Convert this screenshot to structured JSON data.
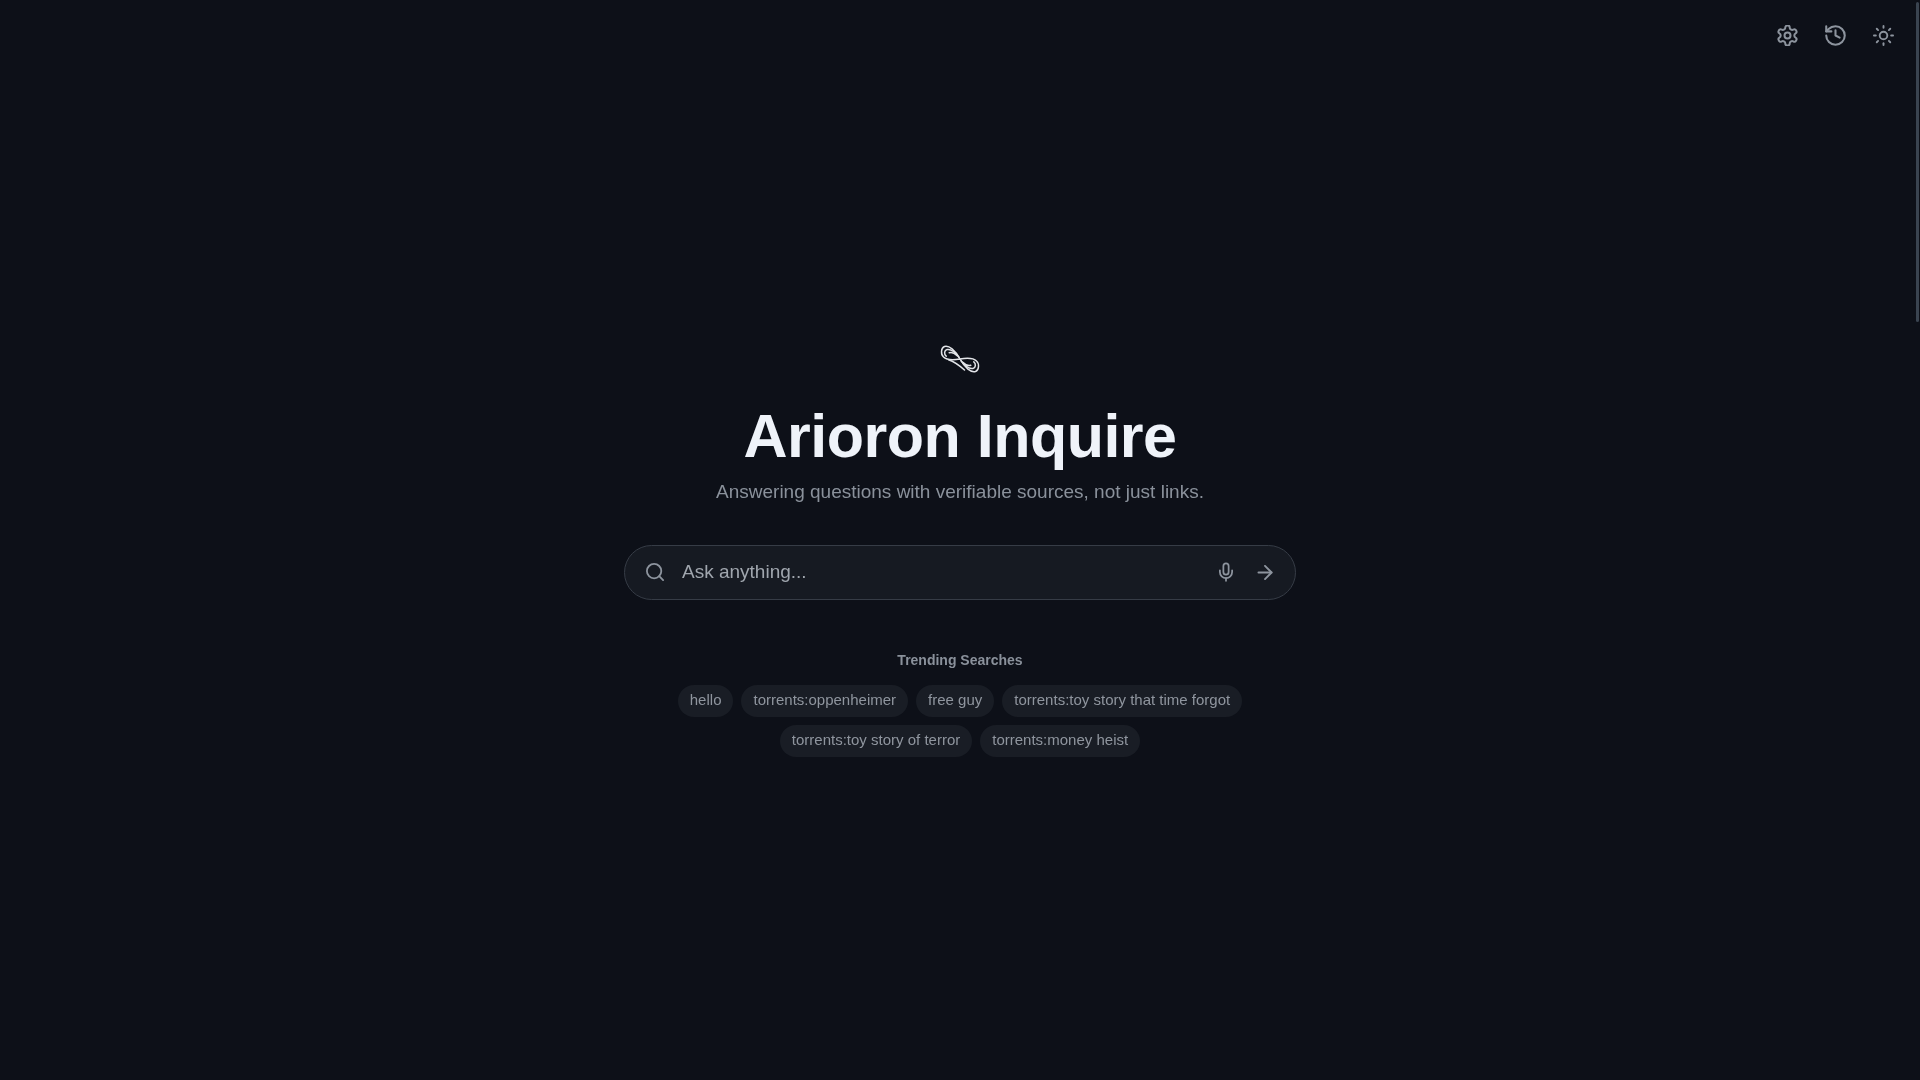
{
  "brand": {
    "title": "Arioron Inquire",
    "tagline": "Answering questions with verifiable sources, not just links."
  },
  "search": {
    "placeholder": "Ask anything..."
  },
  "trending": {
    "heading": "Trending Searches",
    "items": [
      "hello",
      "torrents:oppenheimer",
      "free guy",
      "torrents:toy story that time forgot",
      "torrents:toy story of terror",
      "torrents:money heist"
    ]
  }
}
